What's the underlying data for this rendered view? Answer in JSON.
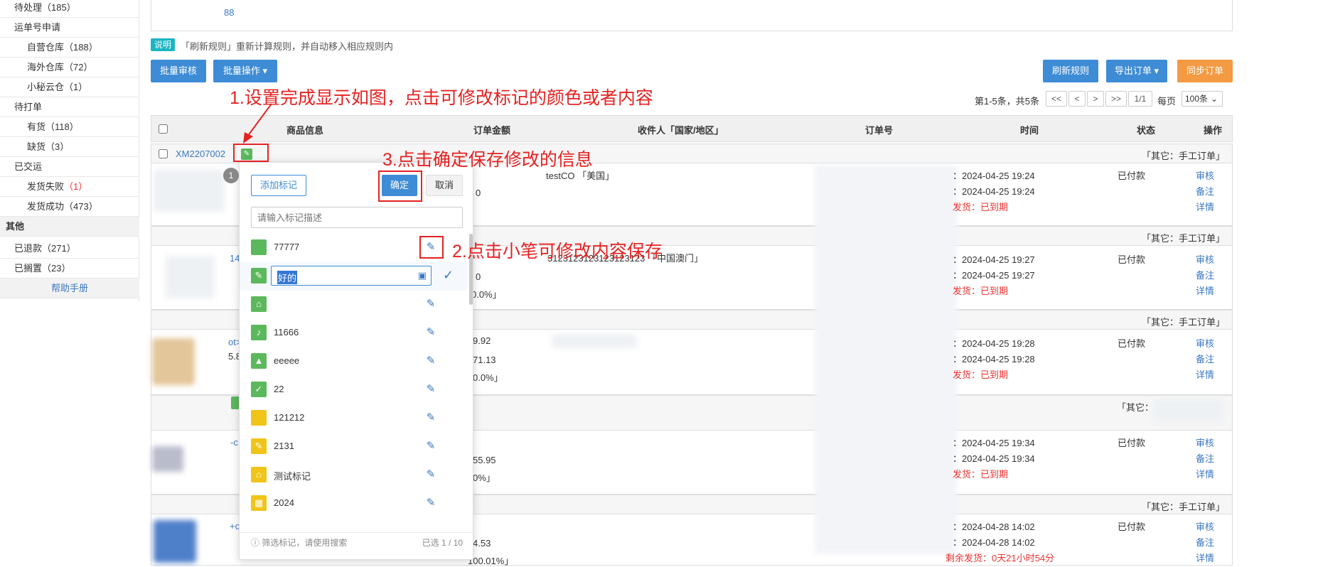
{
  "sidebar": {
    "items": [
      {
        "label": "待处理",
        "count": "（185）"
      },
      {
        "label": "运单号申请",
        "count": ""
      },
      {
        "label": "自营仓库",
        "count": "（188）"
      },
      {
        "label": "海外仓库",
        "count": "（72）"
      },
      {
        "label": "小秘云仓",
        "count": "（1）"
      },
      {
        "label": "待打单",
        "count": ""
      },
      {
        "label": "有货",
        "count": "（118）"
      },
      {
        "label": "缺货",
        "count": "（3）"
      },
      {
        "label": "已交运",
        "count": ""
      },
      {
        "label": "发货失败",
        "count": "（1）"
      },
      {
        "label": "发货成功",
        "count": "（473）"
      },
      {
        "label": "其他",
        "count": ""
      },
      {
        "label": "已退款",
        "count": "（271）"
      },
      {
        "label": "已搁置",
        "count": "（23）"
      },
      {
        "label": "帮助手册",
        "count": ""
      }
    ]
  },
  "top": {
    "number": "88"
  },
  "notice": {
    "badge": "说明",
    "text": "「刷新规则」重新计算规则，并自动移入相应规则内"
  },
  "toolbar": {
    "batch_review": "批量审核",
    "batch_ops": "批量操作",
    "refresh_rules": "刷新规则",
    "export_orders": "导出订单",
    "sync_orders": "同步订单"
  },
  "pagination": {
    "summary": "第1-5条，共5条",
    "first": "<<",
    "prev": "<",
    "next": ">",
    "last": ">>",
    "page": "1/1",
    "per_page_label": "每页",
    "per_page": "100条"
  },
  "table": {
    "headers": [
      "商品信息",
      "订单金额",
      "收件人「国家/地区」",
      "订单号",
      "时间",
      "状态",
      "操作"
    ]
  },
  "orders": [
    {
      "id": "XM2207002",
      "tag": "「其它：手工订单」",
      "recipient": "testCO 「美国」",
      "t1": "2024-04-25 19:24",
      "t2": "2024-04-25 19:24",
      "t3": "已到期",
      "status": "已付款"
    },
    {
      "tag": "「其它：手工订单」",
      "recipient": "3123123123123123123 「中国澳门」",
      "t1": "2024-04-25 19:27",
      "t2": "2024-04-25 19:27",
      "t3": "已到期",
      "status": "已付款",
      "side": "14"
    },
    {
      "tag": "「其它：手工订单」",
      "recipient": "",
      "t1": "2024-04-25 19:28",
      "t2": "2024-04-25 19:28",
      "t3": "已到期",
      "status": "已付款",
      "amt1": "9.92",
      "amt2": "71.13",
      "amt3": "0.0%」",
      "side": "ot>",
      "side2": "5.8"
    },
    {
      "tag": "「其它：",
      "recipient": "",
      "t1": "2024-04-25 19:34",
      "t2": "2024-04-25 19:34",
      "t3": "已到期",
      "status": "已付款",
      "amt1": "55.95",
      "amt3": "0%」",
      "side": "-c"
    },
    {
      "tag": "「其它：手工订单」",
      "recipient": "",
      "t1": "2024-04-28 14:02",
      "t2": "2024-04-28 14:02",
      "t3": "0天21小时54分",
      "status": "已付款",
      "amt1": "4.53",
      "amt3": "100.01%」",
      "side": "+c"
    }
  ],
  "order_misc": {
    "amt_r1": "0",
    "amt_r2a": "0",
    "amt_r2b": "0.0%」",
    "pay_prefix": "：",
    "ship_prefix": "发货：",
    "ship_prefix_full": "剩余发货："
  },
  "actions": {
    "review": "审核",
    "note": "备注",
    "detail": "详情"
  },
  "annotations": {
    "a1": "1.设置完成显示如图，点击可修改标记的颜色或者内容",
    "a2": "2.点击小笔可修改内容保存",
    "a3": "3.点击确定保存修改的信息"
  },
  "popup": {
    "badge": "1",
    "add_tag": "添加标记",
    "confirm": "确定",
    "cancel": "取消",
    "search_placeholder": "请输入标记描述",
    "editing_value": "好的",
    "tags": [
      {
        "label": "77777",
        "color": "#5cb85c",
        "icon": "square"
      },
      {
        "label": "",
        "color": "#5cb85c",
        "icon": "house-icon"
      },
      {
        "label": "11666",
        "color": "#5cb85c",
        "icon": "bell-icon"
      },
      {
        "label": "eeeee",
        "color": "#5cb85c",
        "icon": "warning-icon"
      },
      {
        "label": "22",
        "color": "#5cb85c",
        "icon": "check-circle-icon"
      },
      {
        "label": "121212",
        "color": "#f0c419",
        "icon": "square"
      },
      {
        "label": "2131",
        "color": "#f0c419",
        "icon": "note-icon"
      },
      {
        "label": "测试标记",
        "color": "#f0c419",
        "icon": "house-icon"
      },
      {
        "label": "2024",
        "color": "#f0c419",
        "icon": "calendar-icon"
      }
    ],
    "footer_hint": "筛选标记，请使用搜索",
    "footer_count": "已选 1 / 10"
  },
  "colors": {
    "accent": "#3e8cd6",
    "orange": "#f39a42",
    "annotation": "#e52222",
    "tag_green": "#5cb85c",
    "tag_yellow": "#f0c419"
  }
}
